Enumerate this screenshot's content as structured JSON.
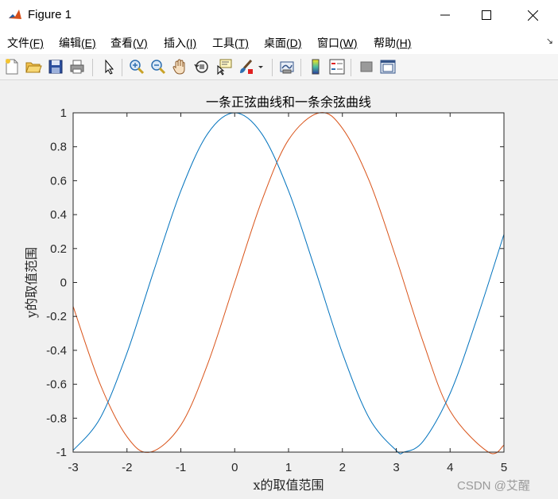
{
  "window": {
    "title": "Figure 1",
    "minimize_glyph": "—",
    "close_glyph": "✕"
  },
  "menubar": {
    "items": [
      {
        "label": "文件",
        "accel": "(F)"
      },
      {
        "label": "编辑",
        "accel": "(E)"
      },
      {
        "label": "查看",
        "accel": "(V)"
      },
      {
        "label": "插入",
        "accel": "(I)"
      },
      {
        "label": "工具",
        "accel": "(T)"
      },
      {
        "label": "桌面",
        "accel": "(D)"
      },
      {
        "label": "窗口",
        "accel": "(W)"
      },
      {
        "label": "帮助",
        "accel": "(H)"
      }
    ],
    "overflow_glyph": "↘"
  },
  "toolbar": {
    "buttons": [
      "new-figure-icon",
      "open-file-icon",
      "save-icon",
      "print-icon",
      "select-arrow-icon",
      "zoom-in-icon",
      "zoom-out-icon",
      "pan-hand-icon",
      "rotate-3d-icon",
      "data-cursor-icon",
      "brush-icon",
      "link-plot-icon",
      "colorbar-icon",
      "legend-icon",
      "hide-plot-tools-icon",
      "show-plot-tools-icon"
    ]
  },
  "watermark": "CSDN @艾醒",
  "colors": {
    "series_sin": "#D95319",
    "series_cos": "#0072BD",
    "axes_bg": "#ffffff",
    "figure_bg": "#f0f0f0"
  },
  "chart_data": {
    "type": "line",
    "title": "一条正弦曲线和一条余弦曲线",
    "xlabel": "x的取值范围",
    "ylabel": "y的取值范围",
    "xlim": [
      -3,
      5
    ],
    "ylim": [
      -1,
      1
    ],
    "xticks": [
      "-3",
      "-2",
      "-1",
      "0",
      "1",
      "2",
      "3",
      "4",
      "5"
    ],
    "yticks": [
      "-1",
      "-0.8",
      "-0.6",
      "-0.4",
      "-0.2",
      "0",
      "0.2",
      "0.4",
      "0.6",
      "0.8",
      "1"
    ],
    "grid": false,
    "series": [
      {
        "function": "sin",
        "x": [
          -3.0,
          -2.5,
          -2.0,
          -1.571,
          -1.0,
          -0.5,
          0.0,
          0.5,
          1.0,
          1.571,
          2.0,
          2.5,
          3.0,
          3.5,
          4.0,
          4.712,
          5.0
        ],
        "y": [
          -0.141,
          -0.598,
          -0.909,
          -1.0,
          -0.841,
          -0.479,
          0.0,
          0.479,
          0.841,
          1.0,
          0.909,
          0.598,
          0.141,
          -0.351,
          -0.757,
          -1.0,
          -0.959
        ]
      },
      {
        "function": "cos",
        "x": [
          -3.0,
          -2.5,
          -2.0,
          -1.5,
          -1.0,
          -0.5,
          0.0,
          0.5,
          1.0,
          1.5,
          2.0,
          2.5,
          3.0,
          3.142,
          3.5,
          4.0,
          4.5,
          5.0
        ],
        "y": [
          -0.99,
          -0.801,
          -0.416,
          0.071,
          0.54,
          0.878,
          1.0,
          0.878,
          0.54,
          0.071,
          -0.416,
          -0.801,
          -0.99,
          -1.0,
          -0.936,
          -0.654,
          -0.211,
          0.284
        ]
      }
    ]
  }
}
